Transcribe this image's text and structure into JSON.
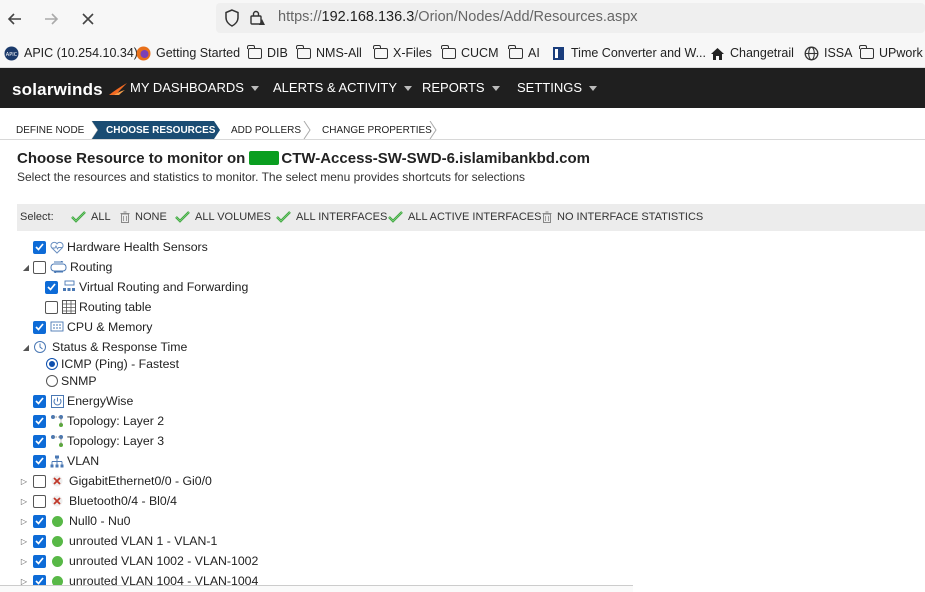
{
  "browser": {
    "url_prefix": "https://",
    "url_host": "192.168.136.3",
    "url_path": "/Orion/Nodes/Add/Resources.aspx"
  },
  "bookmarks": [
    {
      "label": "APIC (10.254.10.34)",
      "icon": "apic-icon"
    },
    {
      "label": "Getting Started",
      "icon": "firefox-icon"
    },
    {
      "label": "DIB",
      "icon": "folder-icon"
    },
    {
      "label": "NMS-All",
      "icon": "folder-icon"
    },
    {
      "label": "X-Files",
      "icon": "folder-icon"
    },
    {
      "label": "CUCM",
      "icon": "folder-icon"
    },
    {
      "label": "AI",
      "icon": "folder-icon"
    },
    {
      "label": "Time Converter and W...",
      "icon": "timeconv-icon"
    },
    {
      "label": "Changetrail",
      "icon": "home-icon"
    },
    {
      "label": "ISSA",
      "icon": "globe-icon"
    },
    {
      "label": "UPwork",
      "icon": "folder-icon"
    }
  ],
  "app": {
    "logo": "solarwinds",
    "menu": [
      "MY DASHBOARDS",
      "ALERTS & ACTIVITY",
      "REPORTS",
      "SETTINGS"
    ]
  },
  "wizard": {
    "steps": [
      "DEFINE NODE",
      "CHOOSE RESOURCES",
      "ADD POLLERS",
      "CHANGE PROPERTIES"
    ],
    "active": 1
  },
  "page": {
    "title_prefix": "Choose Resource to monitor on",
    "title_node": "CTW-Access-SW-SWD-6.islamibankbd.com",
    "subtitle": "Select the resources and statistics to monitor. The select menu provides shortcuts for selections"
  },
  "select_bar": {
    "label": "Select:",
    "options": [
      {
        "label": "ALL",
        "icon": "check-icon"
      },
      {
        "label": "NONE",
        "icon": "trash-icon"
      },
      {
        "label": "ALL VOLUMES",
        "icon": "check-icon"
      },
      {
        "label": "ALL INTERFACES",
        "icon": "check-icon"
      },
      {
        "label": "ALL ACTIVE INTERFACES",
        "icon": "check-icon"
      },
      {
        "label": "NO INTERFACE STATISTICS",
        "icon": "trash-icon"
      }
    ]
  },
  "tree": [
    {
      "label": "Hardware Health Sensors",
      "control": "checkbox",
      "checked": true,
      "icon": "heartbeat-icon",
      "expander": "none"
    },
    {
      "label": "Routing",
      "control": "checkbox",
      "checked": false,
      "icon": "routing-icon",
      "expander": "expanded"
    },
    {
      "label": "Virtual Routing and Forwarding",
      "control": "checkbox",
      "checked": true,
      "icon": "vrf-icon",
      "expander": "none"
    },
    {
      "label": "Routing table",
      "control": "checkbox",
      "checked": false,
      "icon": "table-icon",
      "expander": "none"
    },
    {
      "label": "CPU & Memory",
      "control": "checkbox",
      "checked": true,
      "icon": "cpu-icon",
      "expander": "none"
    },
    {
      "label": "Status & Response Time",
      "control": "none",
      "checked": false,
      "icon": "status-icon",
      "expander": "expanded"
    },
    {
      "label": "ICMP (Ping) - Fastest",
      "control": "radio",
      "checked": true,
      "icon": "",
      "expander": "none"
    },
    {
      "label": "SNMP",
      "control": "radio",
      "checked": false,
      "icon": "",
      "expander": "none"
    },
    {
      "label": "EnergyWise",
      "control": "checkbox",
      "checked": true,
      "icon": "power-icon",
      "expander": "none"
    },
    {
      "label": "Topology: Layer 2",
      "control": "checkbox",
      "checked": true,
      "icon": "topology-icon",
      "expander": "none"
    },
    {
      "label": "Topology: Layer 3",
      "control": "checkbox",
      "checked": true,
      "icon": "topology-icon",
      "expander": "none"
    },
    {
      "label": "VLAN",
      "control": "checkbox",
      "checked": true,
      "icon": "vlan-icon",
      "expander": "none"
    },
    {
      "label": "GigabitEthernet0/0 - Gi0/0",
      "control": "checkbox",
      "checked": false,
      "icon": "status-down-icon",
      "expander": "collapsed"
    },
    {
      "label": "Bluetooth0/4 - Bl0/4",
      "control": "checkbox",
      "checked": false,
      "icon": "status-down-icon",
      "expander": "collapsed"
    },
    {
      "label": "Null0 - Nu0",
      "control": "checkbox",
      "checked": true,
      "icon": "status-up-icon",
      "expander": "collapsed"
    },
    {
      "label": "unrouted VLAN 1 - VLAN-1",
      "control": "checkbox",
      "checked": true,
      "icon": "status-up-icon",
      "expander": "collapsed"
    },
    {
      "label": "unrouted VLAN 1002 - VLAN-1002",
      "control": "checkbox",
      "checked": true,
      "icon": "status-up-icon",
      "expander": "collapsed"
    },
    {
      "label": "unrouted VLAN 1004 - VLAN-1004",
      "control": "checkbox",
      "checked": true,
      "icon": "status-up-icon",
      "expander": "collapsed"
    }
  ]
}
